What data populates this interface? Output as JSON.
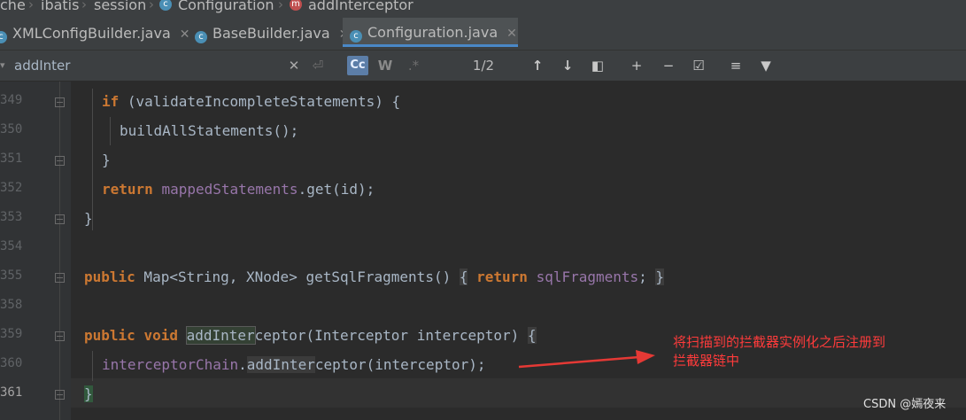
{
  "breadcrumb": {
    "items": [
      "che",
      "ibatis",
      "session",
      "Configuration",
      "addInterceptor"
    ]
  },
  "tabs": [
    {
      "label": "XMLConfigBuilder.java",
      "active": false
    },
    {
      "label": "BaseBuilder.java",
      "active": false
    },
    {
      "label": "Configuration.java",
      "active": true
    }
  ],
  "search": {
    "query": "addInter",
    "match_count": "1/2",
    "case_label": "Cc",
    "word_label": "W",
    "regex_label": ".*"
  },
  "line_numbers": [
    "349",
    "350",
    "351",
    "352",
    "353",
    "354",
    "355",
    "358",
    "359",
    "360",
    "361"
  ],
  "annotation": {
    "text_line1": "将扫描到的拦截器实例化之后注册到",
    "text_line2": "拦截器链中"
  },
  "watermark": "CSDN @嫣夜来",
  "colors": {
    "editor_bg": "#2b2b2b",
    "keyword": "#cc7832",
    "field": "#9876aa",
    "arrow": "#e53935"
  }
}
